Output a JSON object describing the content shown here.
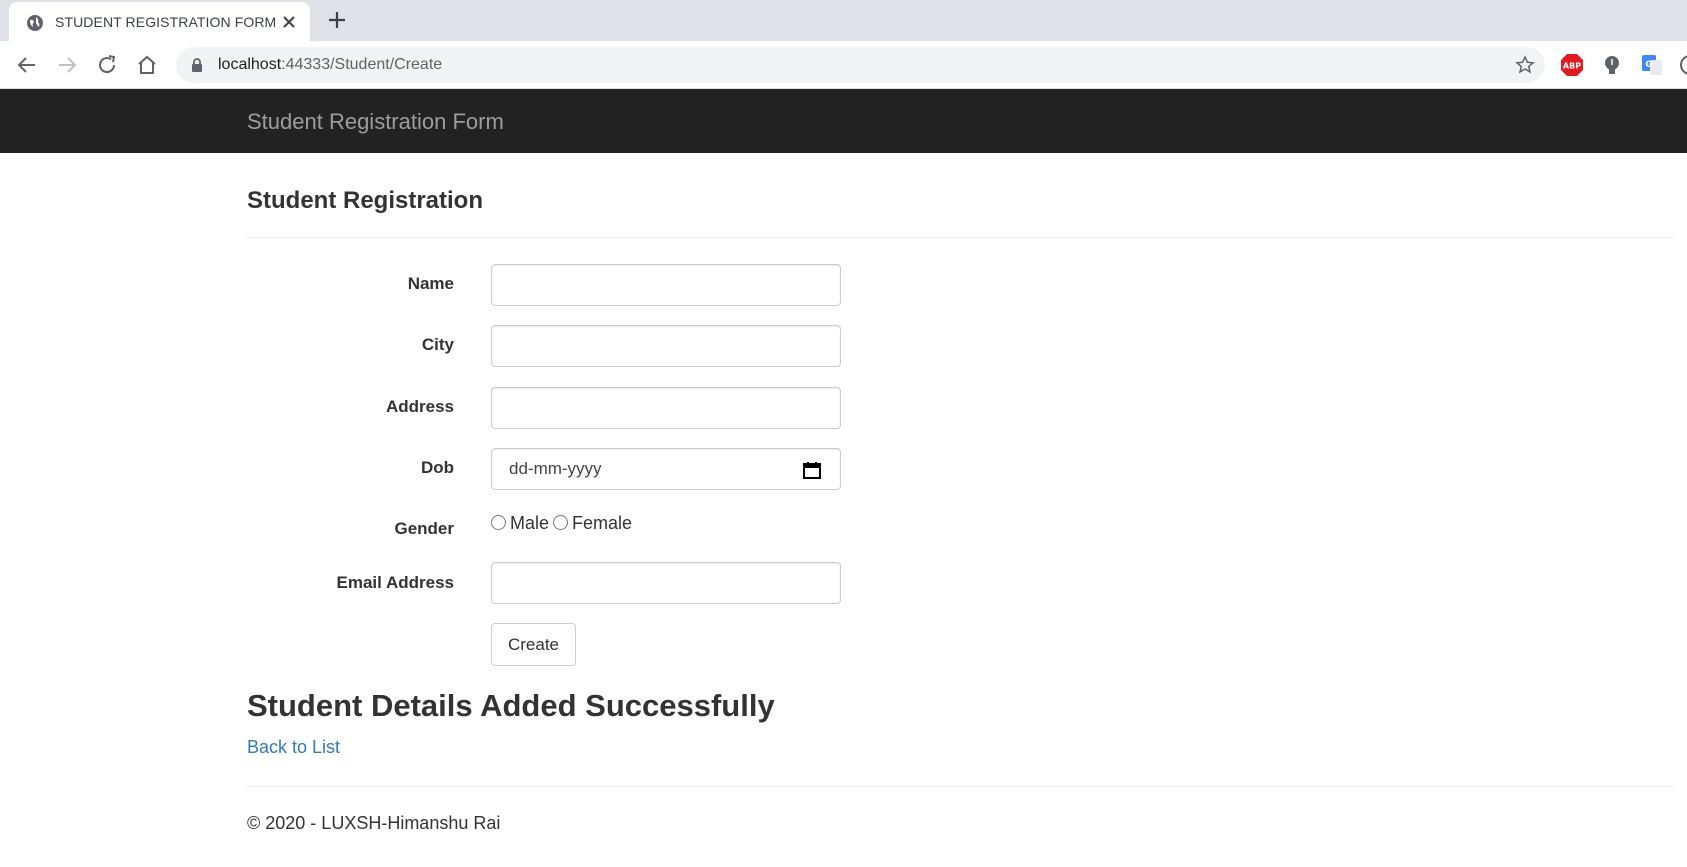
{
  "browser": {
    "tab_title": "STUDENT REGISTRATION FORM",
    "url_host": "localhost",
    "url_rest": ":44333/Student/Create",
    "abp_label": "ABP"
  },
  "navbar": {
    "brand": "Student Registration Form"
  },
  "main": {
    "title": "Student Registration",
    "fields": {
      "name_label": "Name",
      "city_label": "City",
      "address_label": "Address",
      "dob_label": "Dob",
      "dob_placeholder": "dd-mm-yyyy",
      "gender_label": "Gender",
      "gender_options": [
        "Male",
        "Female"
      ],
      "email_label": "Email Address"
    },
    "create_label": "Create",
    "success_message": "Student Details Added Successfully",
    "back_link": "Back to List"
  },
  "footer": {
    "text": "© 2020 - LUXSH-Himanshu Rai"
  }
}
